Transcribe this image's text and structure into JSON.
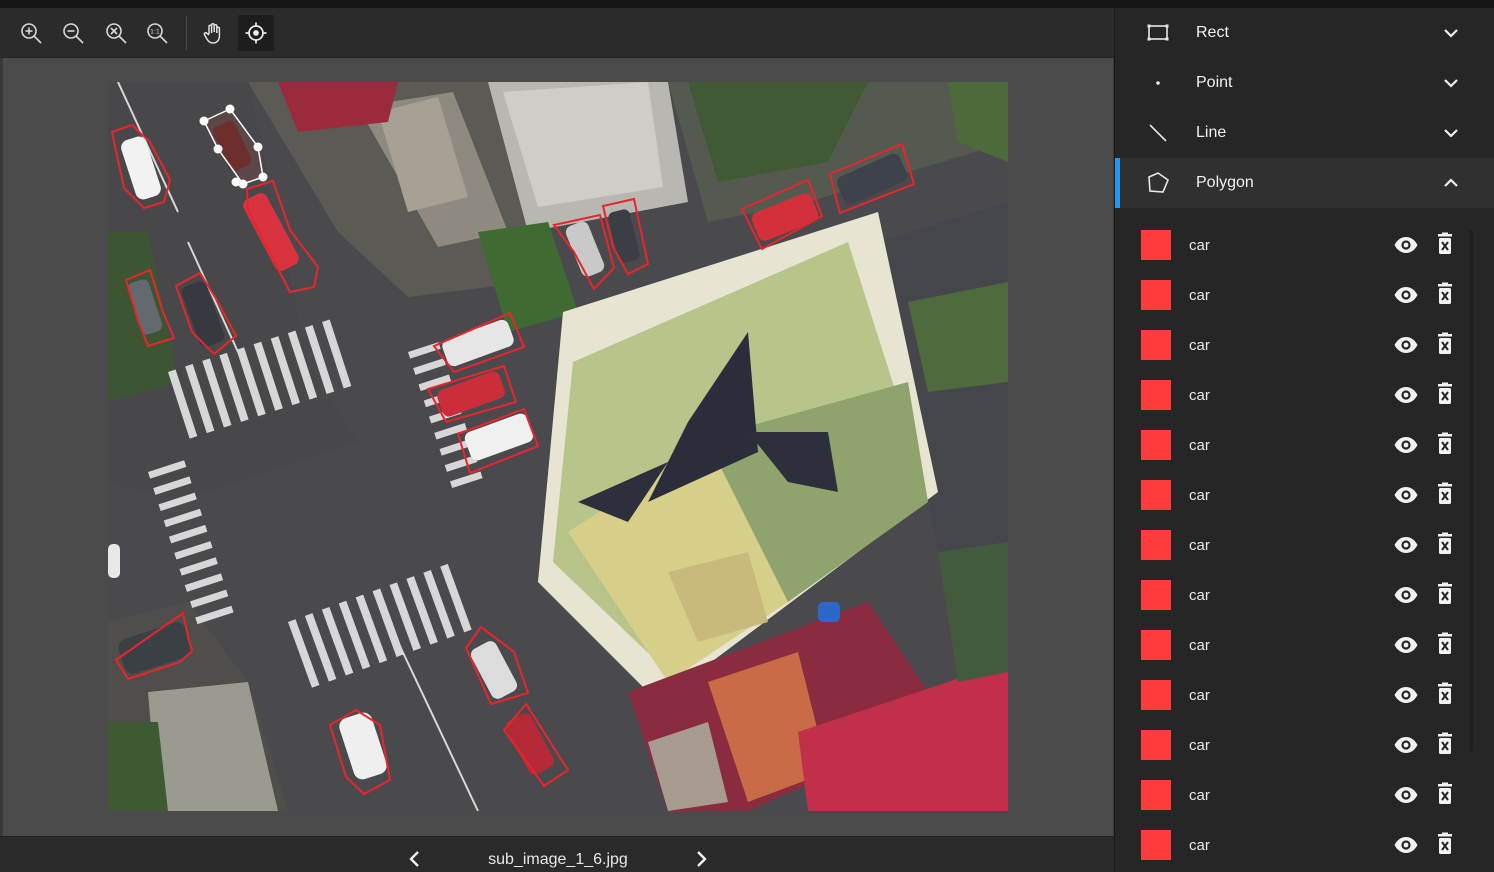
{
  "toolbar": {
    "tools": [
      {
        "icon": "zoom-in-icon"
      },
      {
        "icon": "zoom-out-icon"
      },
      {
        "icon": "zoom-fit-icon"
      },
      {
        "icon": "zoom-actual-size-icon",
        "glyph": "1:1"
      },
      {
        "icon": "pan-hand-icon"
      },
      {
        "icon": "crosshair-select-icon",
        "active": true
      }
    ]
  },
  "footer": {
    "filename": "sub_image_1_6.jpg",
    "prev_icon": "chevron-left-icon",
    "next_icon": "chevron-right-icon"
  },
  "sidebar": {
    "categories": [
      {
        "label": "Rect",
        "icon": "rectangle-icon",
        "expanded": false
      },
      {
        "label": "Point",
        "icon": "point-icon",
        "expanded": false
      },
      {
        "label": "Line",
        "icon": "line-icon",
        "expanded": false
      },
      {
        "label": "Polygon",
        "icon": "polygon-icon",
        "expanded": true
      }
    ],
    "annotations": [
      {
        "label": "car",
        "color": "#ff3b3b"
      },
      {
        "label": "car",
        "color": "#ff3b3b"
      },
      {
        "label": "car",
        "color": "#ff3b3b"
      },
      {
        "label": "car",
        "color": "#ff3b3b"
      },
      {
        "label": "car",
        "color": "#ff3b3b"
      },
      {
        "label": "car",
        "color": "#ff3b3b"
      },
      {
        "label": "car",
        "color": "#ff3b3b"
      },
      {
        "label": "car",
        "color": "#ff3b3b"
      },
      {
        "label": "car",
        "color": "#ff3b3b"
      },
      {
        "label": "car",
        "color": "#ff3b3b"
      },
      {
        "label": "car",
        "color": "#ff3b3b"
      },
      {
        "label": "car",
        "color": "#ff3b3b"
      },
      {
        "label": "car",
        "color": "#ff3b3b"
      }
    ]
  },
  "colors": {
    "accent": "#2196f3",
    "annotation": "#ff3b3b",
    "polygon_stroke": "#e8252b",
    "selected_vertex": "#ffffff"
  }
}
